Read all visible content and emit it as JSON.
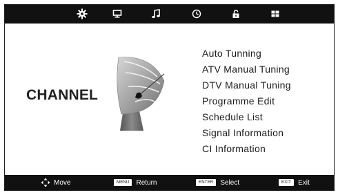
{
  "tabs": [
    {
      "icon": "gear-icon",
      "selected": true
    },
    {
      "icon": "monitor-icon",
      "selected": false
    },
    {
      "icon": "music-note-icon",
      "selected": false
    },
    {
      "icon": "clock-icon",
      "selected": false
    },
    {
      "icon": "lock-icon",
      "selected": false
    },
    {
      "icon": "grid-icon",
      "selected": false
    }
  ],
  "page_title": "CHANNEL",
  "menu_items": [
    "Auto Tunning",
    "ATV Manual Tuning",
    "DTV Manual Tuning",
    "Programme Edit",
    "Schedule List",
    "Signal Information",
    "CI Information"
  ],
  "footer": {
    "move_label": "Move",
    "menu_key": "MENU",
    "menu_label": "Return",
    "enter_key": "ENTER",
    "enter_label": "Select",
    "exit_key": "EXIT",
    "exit_label": "Exit"
  },
  "colors": {
    "bar": "#111111",
    "text": "#1a1a1a",
    "background": "#ffffff"
  }
}
